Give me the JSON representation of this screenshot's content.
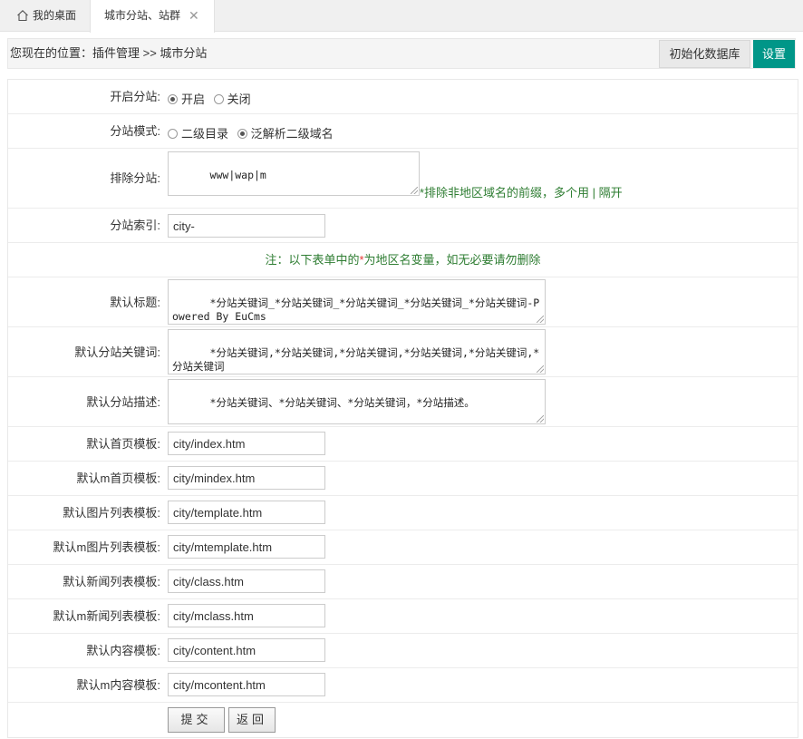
{
  "tabs": {
    "home_label": "我的桌面",
    "active_label": "城市分站、站群",
    "close_glyph": "✕"
  },
  "location": {
    "text": "您现在的位置：插件管理 >> 城市分站"
  },
  "toolbar": {
    "init_db_label": "初始化数据库",
    "settings_label": "设置",
    "accent_color": "#009688"
  },
  "form": {
    "enable_label": "开启分站:",
    "enable_options": [
      {
        "label": "开启",
        "checked": true
      },
      {
        "label": "关闭",
        "checked": false
      }
    ],
    "mode_label": "分站模式:",
    "mode_options": [
      {
        "label": "二级目录",
        "checked": false
      },
      {
        "label": "泛解析二级域名",
        "checked": true
      }
    ],
    "exclude_label": "排除分站:",
    "exclude_value": "www|wap|m",
    "exclude_hint": "*排除非地区域名的前缀，多个用 | 隔开",
    "index_label": "分站索引:",
    "index_value": "city-",
    "note_prefix": "注：以下表单中的",
    "note_star": "*",
    "note_suffix": "为地区名变量，如无必要请勿删除",
    "title_label": "默认标题:",
    "title_value": "*分站关键词_*分站关键词_*分站关键词_*分站关键词_*分站关键词-Powered By EuCms",
    "keywords_label": "默认分站关键词:",
    "keywords_value": "*分站关键词,*分站关键词,*分站关键词,*分站关键词,*分站关键词,*分站关键词",
    "desc_label": "默认分站描述:",
    "desc_value": "*分站关键词、*分站关键词、*分站关键词，*分站描述。",
    "templates": [
      {
        "label": "默认首页模板:",
        "value": "city/index.htm"
      },
      {
        "label": "默认m首页模板:",
        "value": "city/mindex.htm"
      },
      {
        "label": "默认图片列表模板:",
        "value": "city/template.htm"
      },
      {
        "label": "默认m图片列表模板:",
        "value": "city/mtemplate.htm"
      },
      {
        "label": "默认新闻列表模板:",
        "value": "city/class.htm"
      },
      {
        "label": "默认m新闻列表模板:",
        "value": "city/mclass.htm"
      },
      {
        "label": "默认内容模板:",
        "value": "city/content.htm"
      },
      {
        "label": "默认m内容模板:",
        "value": "city/mcontent.htm"
      }
    ],
    "submit_label": "提交",
    "back_label": "返回"
  }
}
